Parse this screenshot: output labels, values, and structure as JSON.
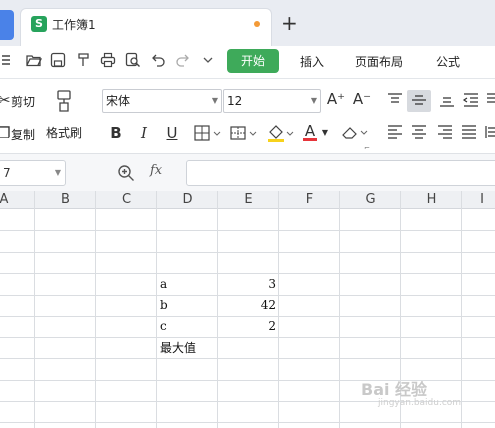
{
  "tabs": {
    "doc_title": "工作簿1",
    "doc_icon": "S",
    "new_tab": "+"
  },
  "toolbar": {
    "quick_icons": [
      "folder-open-icon",
      "save-icon",
      "format-painter-icon",
      "print-icon",
      "print-preview-icon",
      "undo-icon",
      "redo-icon",
      "dropdown-icon"
    ],
    "start_label": "开始",
    "menus": [
      "插入",
      "页面布局",
      "公式"
    ],
    "accent": "#3eaa5a"
  },
  "ribbon": {
    "cut_label": "剪切",
    "copy_label": "复制",
    "format_painter_label": "格式刷",
    "font_name": "宋体",
    "font_size": "12",
    "bold": "B",
    "italic": "I",
    "underline": "U",
    "font_color_letter": "A",
    "increase_font": "A⁺",
    "decrease_font": "A⁻"
  },
  "formula_bar": {
    "name_box": "7",
    "fx": "fx",
    "formula": ""
  },
  "grid": {
    "columns": [
      "A",
      "B",
      "C",
      "D",
      "E",
      "F",
      "G",
      "H",
      "I"
    ],
    "cells": [
      {
        "label": "a",
        "value": "3"
      },
      {
        "label": "b",
        "value": "42"
      },
      {
        "label": "c",
        "value": "2"
      },
      {
        "label": "最大值",
        "value": ""
      }
    ]
  },
  "watermark": {
    "main": "Bai 经验",
    "sub": "jingyan.baidu.com"
  }
}
